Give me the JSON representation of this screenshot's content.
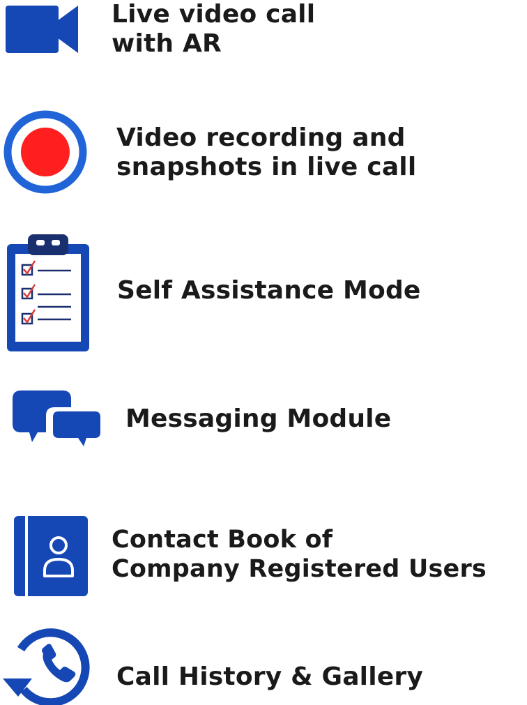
{
  "colors": {
    "accent_blue": "#1547b5",
    "record_blue": "#2164d8",
    "record_red": "#ff1f1f",
    "text": "#1a1a1a",
    "check_red": "#d63a3a"
  },
  "features": [
    {
      "icon": "video-camera-icon",
      "lines": [
        "Live video call",
        "with AR"
      ]
    },
    {
      "icon": "record-icon",
      "lines": [
        "Video recording and",
        "snapshots in live call"
      ]
    },
    {
      "icon": "clipboard-checklist-icon",
      "lines": [
        "Self Assistance Mode"
      ]
    },
    {
      "icon": "chat-bubbles-icon",
      "lines": [
        "Messaging Module"
      ]
    },
    {
      "icon": "contact-book-icon",
      "lines": [
        "Contact Book of",
        "Company Registered Users"
      ]
    },
    {
      "icon": "call-history-icon",
      "lines": [
        "Call History & Gallery"
      ]
    }
  ]
}
